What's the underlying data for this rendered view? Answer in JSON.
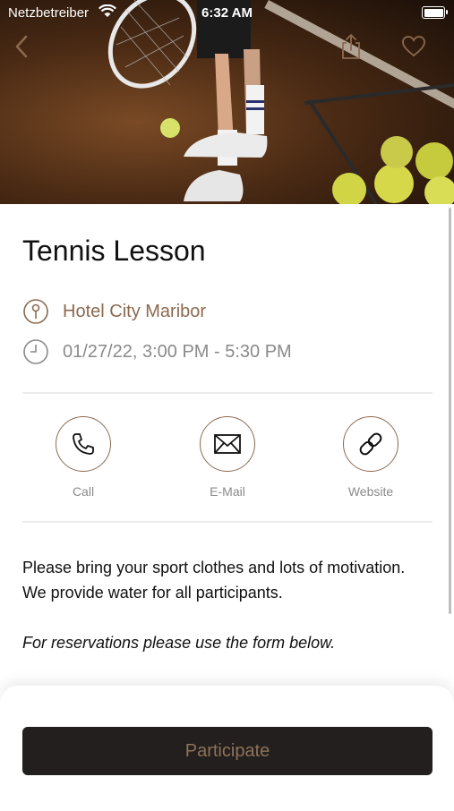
{
  "status_bar": {
    "carrier": "Netzbetreiber",
    "time": "6:32 AM"
  },
  "nav": {
    "back_icon": "chevron-left-icon",
    "share_icon": "share-icon",
    "favorite_icon": "heart-icon"
  },
  "event": {
    "title": "Tennis Lesson",
    "location": "Hotel City Maribor",
    "datetime": "01/27/22, 3:00 PM - 5:30 PM"
  },
  "actions": [
    {
      "label": "Call",
      "icon": "phone-icon"
    },
    {
      "label": "E-Mail",
      "icon": "mail-icon"
    },
    {
      "label": "Website",
      "icon": "link-icon"
    }
  ],
  "description": {
    "line1": "Please bring your sport clothes and lots of motivation.",
    "line2": "We provide water for all participants.",
    "line3": "For reservations please use the form below."
  },
  "participate_label": "Participate",
  "colors": {
    "accent": "#8c6a4f",
    "button_bg": "#221f1e",
    "button_text": "#8f7258"
  }
}
